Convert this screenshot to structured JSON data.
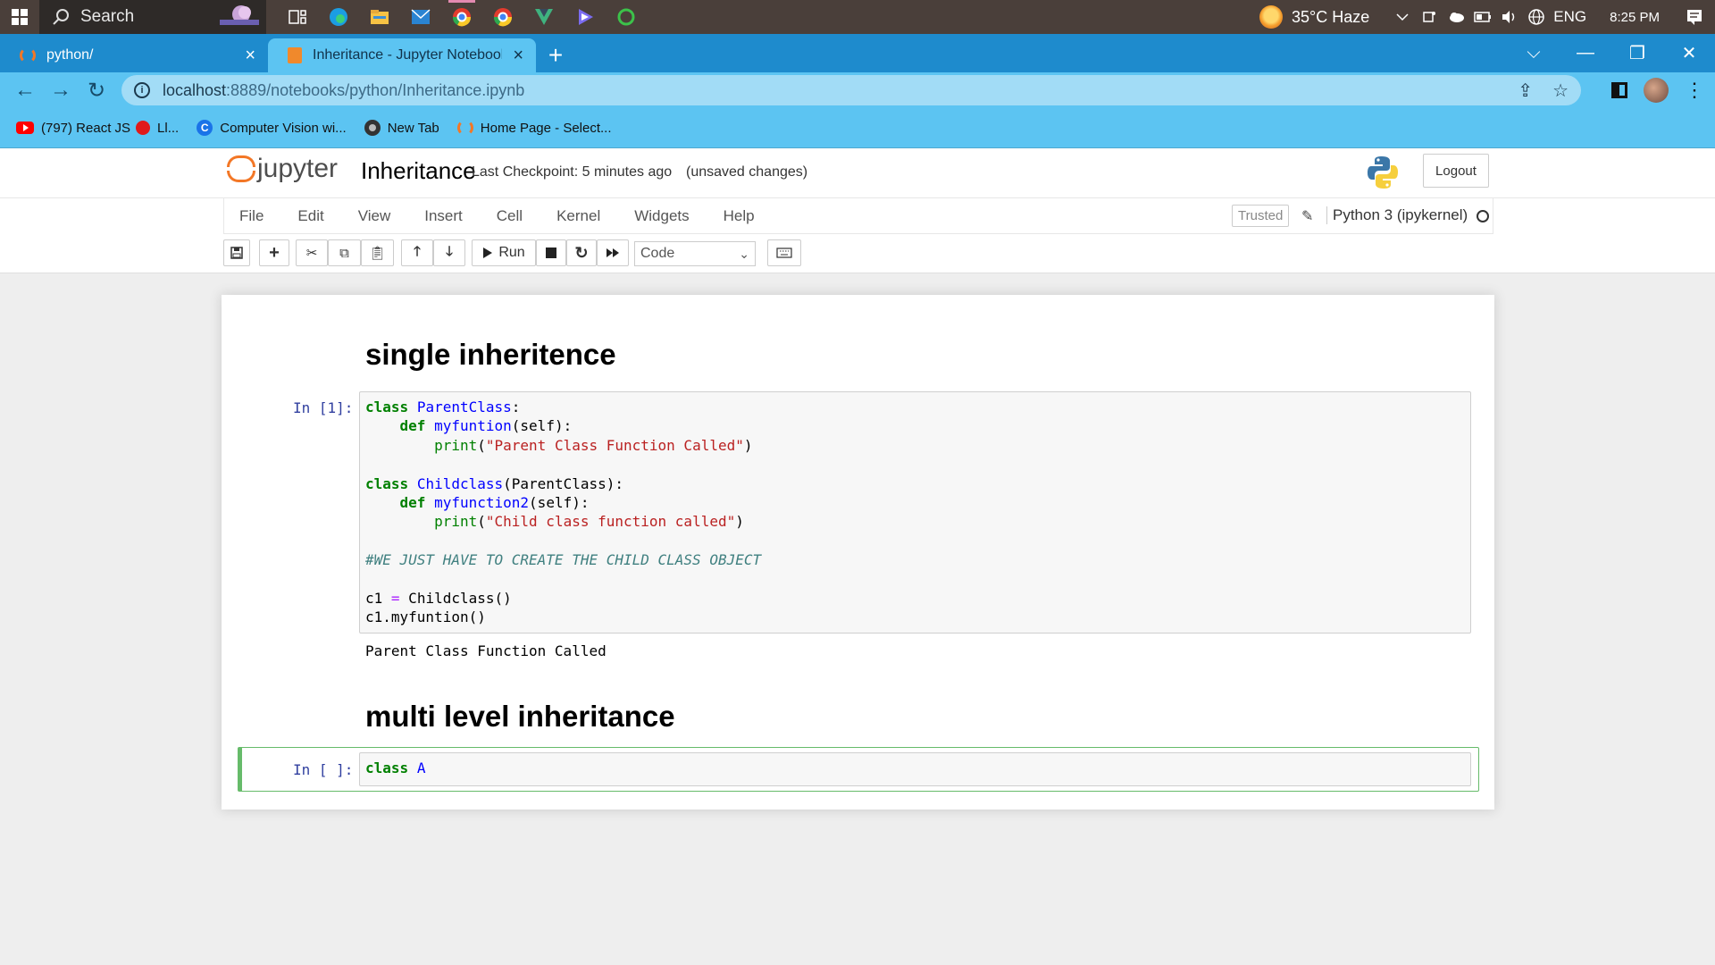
{
  "taskbar": {
    "search_label": "Search",
    "weather": "35°C  Haze",
    "language": "ENG",
    "time": "8:25 PM"
  },
  "browser": {
    "tabs": [
      {
        "title": "python/",
        "active": false
      },
      {
        "title": "Inheritance - Jupyter Notebook",
        "active": true
      }
    ],
    "url_host": "localhost",
    "url_rest": ":8889/notebooks/python/Inheritance.ipynb",
    "bookmarks": [
      {
        "label": "(797) React JS",
        "icon": "youtube-icon"
      },
      {
        "label": "Ll...",
        "icon": "red-circle-icon"
      },
      {
        "label": "Computer Vision wi...",
        "icon": "c-icon"
      },
      {
        "label": "New Tab",
        "icon": "globe-icon"
      },
      {
        "label": "Home Page - Select...",
        "icon": "jupyter-icon"
      }
    ]
  },
  "jupyter": {
    "logo_text": "jupyter",
    "notebook_title": "Inheritance",
    "checkpoint": "Last Checkpoint: 5 minutes ago",
    "autosave": "(unsaved changes)",
    "logout": "Logout",
    "menu": [
      "File",
      "Edit",
      "View",
      "Insert",
      "Cell",
      "Kernel",
      "Widgets",
      "Help"
    ],
    "trusted": "Trusted",
    "kernel": "Python 3 (ipykernel)",
    "run_label": "Run",
    "cell_type": "Code"
  },
  "cells": {
    "heading1": "single inheritence",
    "prompt1": "In [1]:",
    "code1_lines": [
      "class ParentClass:",
      "    def myfuntion(self):",
      "        print(\"Parent Class Function Called\")",
      "",
      "class Childclass(ParentClass):",
      "    def myfunction2(self):",
      "        print(\"Child class function called\")",
      "",
      "#WE JUST HAVE TO CREATE THE CHILD CLASS OBJECT",
      "",
      "c1 = Childclass()",
      "c1.myfuntion()"
    ],
    "output1": "Parent Class Function Called",
    "heading2": "multi level inheritance",
    "prompt2": "In [ ]:",
    "code2": "class A"
  },
  "colors": {
    "jupyter_orange": "#f37726",
    "selected_border": "#66bb6a",
    "prompt_blue": "#303f9f"
  }
}
